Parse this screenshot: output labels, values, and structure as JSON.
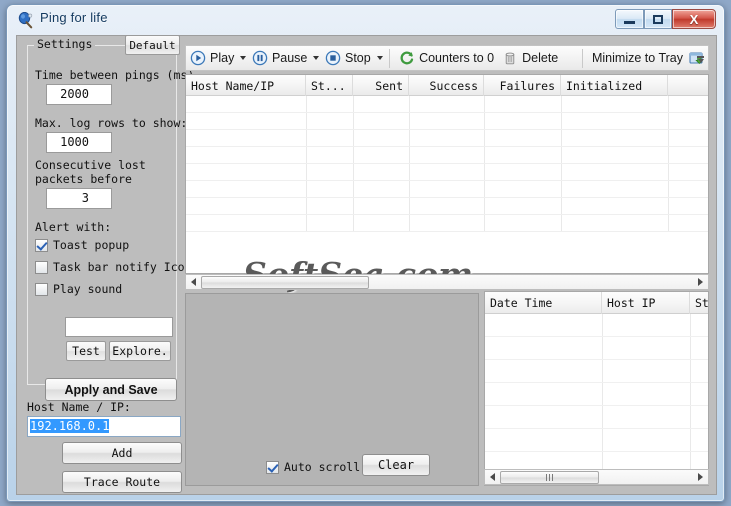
{
  "window": {
    "title": "Ping for life",
    "icon": "ping-paddle-icon",
    "controls": {
      "minimize": "minimize-button",
      "maximize": "maximize-button",
      "close": "close-button",
      "close_glyph": "X"
    }
  },
  "settings": {
    "legend": "Settings",
    "default_button": "Default",
    "time_between_pings_label": "Time between pings (ms)",
    "time_between_pings_value": "2000",
    "max_log_rows_label": "Max. log rows to show:",
    "max_log_rows_value": "1000",
    "consecutive_lost_label_1": "Consecutive lost",
    "consecutive_lost_label_2": "packets before",
    "consecutive_lost_value": "3",
    "alert_with_label": "Alert with:",
    "alerts": [
      {
        "label": "Toast popup",
        "checked": true
      },
      {
        "label": "Task bar notify Ico",
        "checked": false
      },
      {
        "label": "Play sound",
        "checked": false
      }
    ],
    "sound_path_value": "",
    "test_button": "Test",
    "explore_button": "Explore.",
    "apply_button": "Apply and Save"
  },
  "host": {
    "label": "Host Name / IP:",
    "value": "192.168.0.1",
    "add_button": "Add",
    "trace_button": "Trace Route"
  },
  "toolbar": {
    "items": [
      {
        "label": "Play",
        "icon": "play-icon",
        "has_dropdown": true
      },
      {
        "label": "Pause",
        "icon": "pause-icon",
        "has_dropdown": true
      },
      {
        "label": "Stop",
        "icon": "stop-icon",
        "has_dropdown": true
      }
    ],
    "counters_label": "Counters to 0",
    "counters_icon": "refresh-icon",
    "delete_label": "Delete",
    "delete_icon": "trash-icon",
    "minimize_tray_label": "Minimize to Tray",
    "minimize_tray_icon": "tray-minimize-icon",
    "overflow_icon": "toolbar-overflow-chevron-icon"
  },
  "main_grid": {
    "columns": [
      {
        "label": "Host Name/IP",
        "align": "left"
      },
      {
        "label": "St...",
        "align": "left"
      },
      {
        "label": "Sent",
        "align": "right"
      },
      {
        "label": "Success",
        "align": "right"
      },
      {
        "label": "Failures",
        "align": "right"
      },
      {
        "label": "Initialized",
        "align": "left"
      }
    ],
    "rows": [],
    "empty_row_count": 8
  },
  "watermark": "SoftSea.com",
  "log_panel": {
    "auto_scroll_label": "Auto scroll",
    "auto_scroll_checked": true,
    "clear_button": "Clear"
  },
  "event_grid": {
    "columns": [
      {
        "label": "Date Time"
      },
      {
        "label": "Host IP"
      },
      {
        "label": "Stat"
      }
    ],
    "rows": [],
    "empty_row_count": 7
  },
  "colors": {
    "window_frame": "#7a97b8",
    "client_bg": "#bdbdbd",
    "accent_blue": "#2c62b5",
    "selection_blue": "#3399ff",
    "close_red": "#c03a2c",
    "counters_green": "#3f9b3f"
  }
}
